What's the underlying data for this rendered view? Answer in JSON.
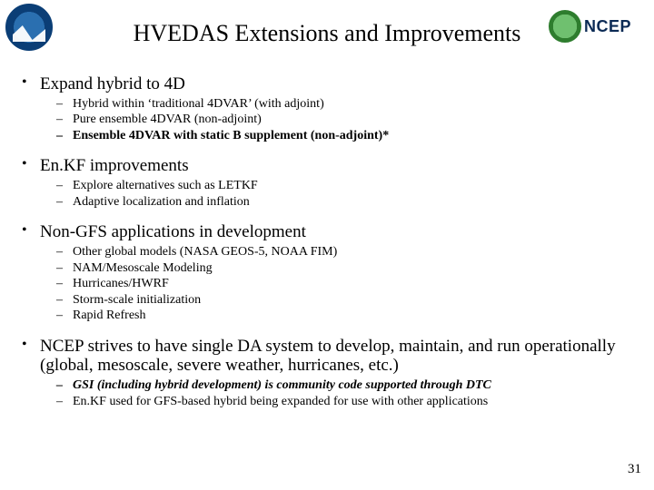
{
  "header": {
    "title": "HVEDAS Extensions and Improvements",
    "ncep_label": "NCEP"
  },
  "bullets": [
    {
      "text": "Expand hybrid to 4D",
      "sub": [
        {
          "text": "Hybrid within ‘traditional 4DVAR’ (with adjoint)"
        },
        {
          "text": "Pure ensemble 4DVAR (non-adjoint)"
        },
        {
          "text": "Ensemble 4DVAR with static B supplement (non-adjoint)*",
          "bold": true
        }
      ]
    },
    {
      "text": "En.KF improvements",
      "sub": [
        {
          "text": "Explore alternatives such as LETKF"
        },
        {
          "text": "Adaptive localization and inflation"
        }
      ]
    },
    {
      "text": "Non-GFS applications in development",
      "sub": [
        {
          "text": "Other global models (NASA GEOS-5, NOAA FIM)"
        },
        {
          "text": "NAM/Mesoscale Modeling"
        },
        {
          "text": "Hurricanes/HWRF"
        },
        {
          "text": "Storm-scale initialization"
        },
        {
          "text": "Rapid Refresh"
        }
      ]
    },
    {
      "text": "NCEP strives to have single DA system to develop, maintain, and run operationally (global, mesoscale, severe weather, hurricanes, etc.)",
      "sub": [
        {
          "text": "GSI (including hybrid development) is community code supported through DTC",
          "bold": true,
          "italic": true
        },
        {
          "text": "En.KF used for GFS-based hybrid being expanded for use with other applications"
        }
      ]
    }
  ],
  "page_number": "31"
}
